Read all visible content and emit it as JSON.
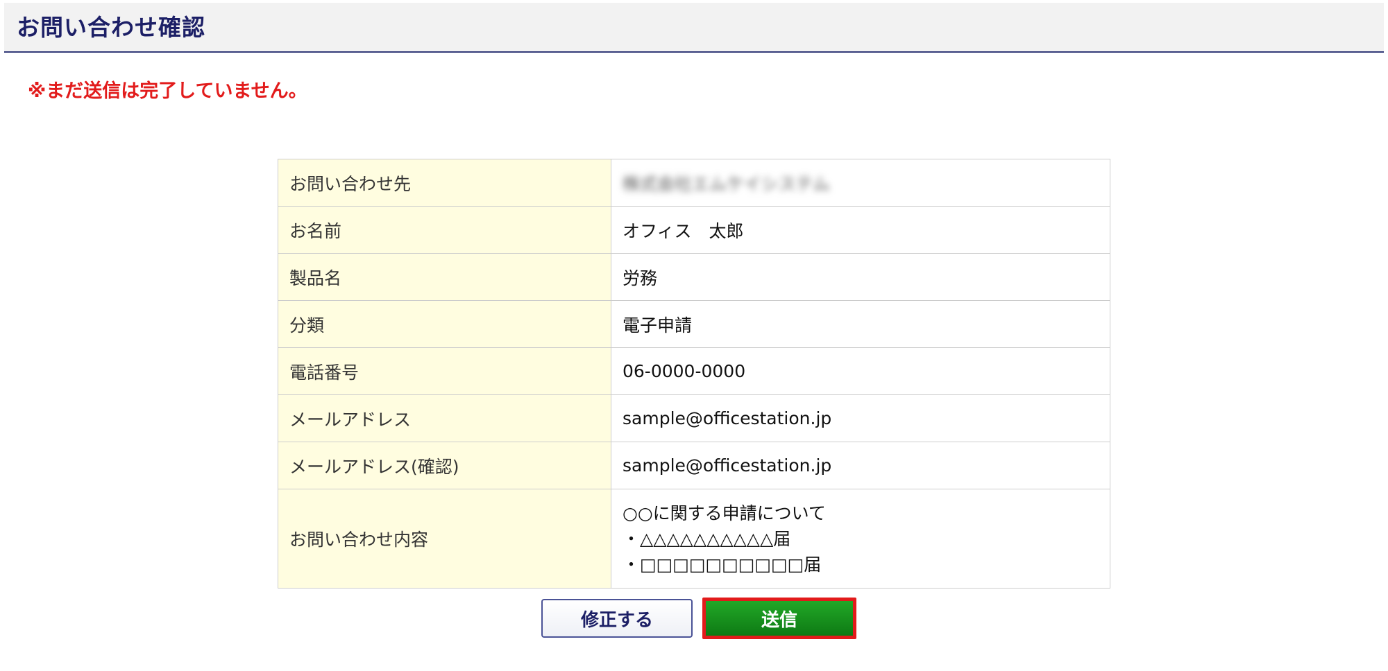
{
  "header": {
    "title": "お問い合わせ確認"
  },
  "warning": "※まだ送信は完了していません。",
  "rows": [
    {
      "label": "お問い合わせ先",
      "value": "株式会社エムケイシステム"
    },
    {
      "label": "お名前",
      "value": "オフィス　太郎"
    },
    {
      "label": "製品名",
      "value": "労務"
    },
    {
      "label": "分類",
      "value": "電子申請"
    },
    {
      "label": "電話番号",
      "value": "06-0000-0000"
    },
    {
      "label": "メールアドレス",
      "value": "sample@officestation.jp"
    },
    {
      "label": "メールアドレス(確認)",
      "value": "sample@officestation.jp"
    },
    {
      "label": "お問い合わせ内容",
      "lines": [
        "○○に関する申請について",
        "・△△△△△△△△△△届",
        "・□□□□□□□□□□届"
      ]
    }
  ],
  "buttons": {
    "edit_label": "修正する",
    "send_label": "送信"
  },
  "colors": {
    "title": "#1c1f66",
    "warning": "#e21b1b",
    "label_bg": "#fffde0",
    "send_bg": "#17931d",
    "send_highlight": "#e21b1b"
  }
}
